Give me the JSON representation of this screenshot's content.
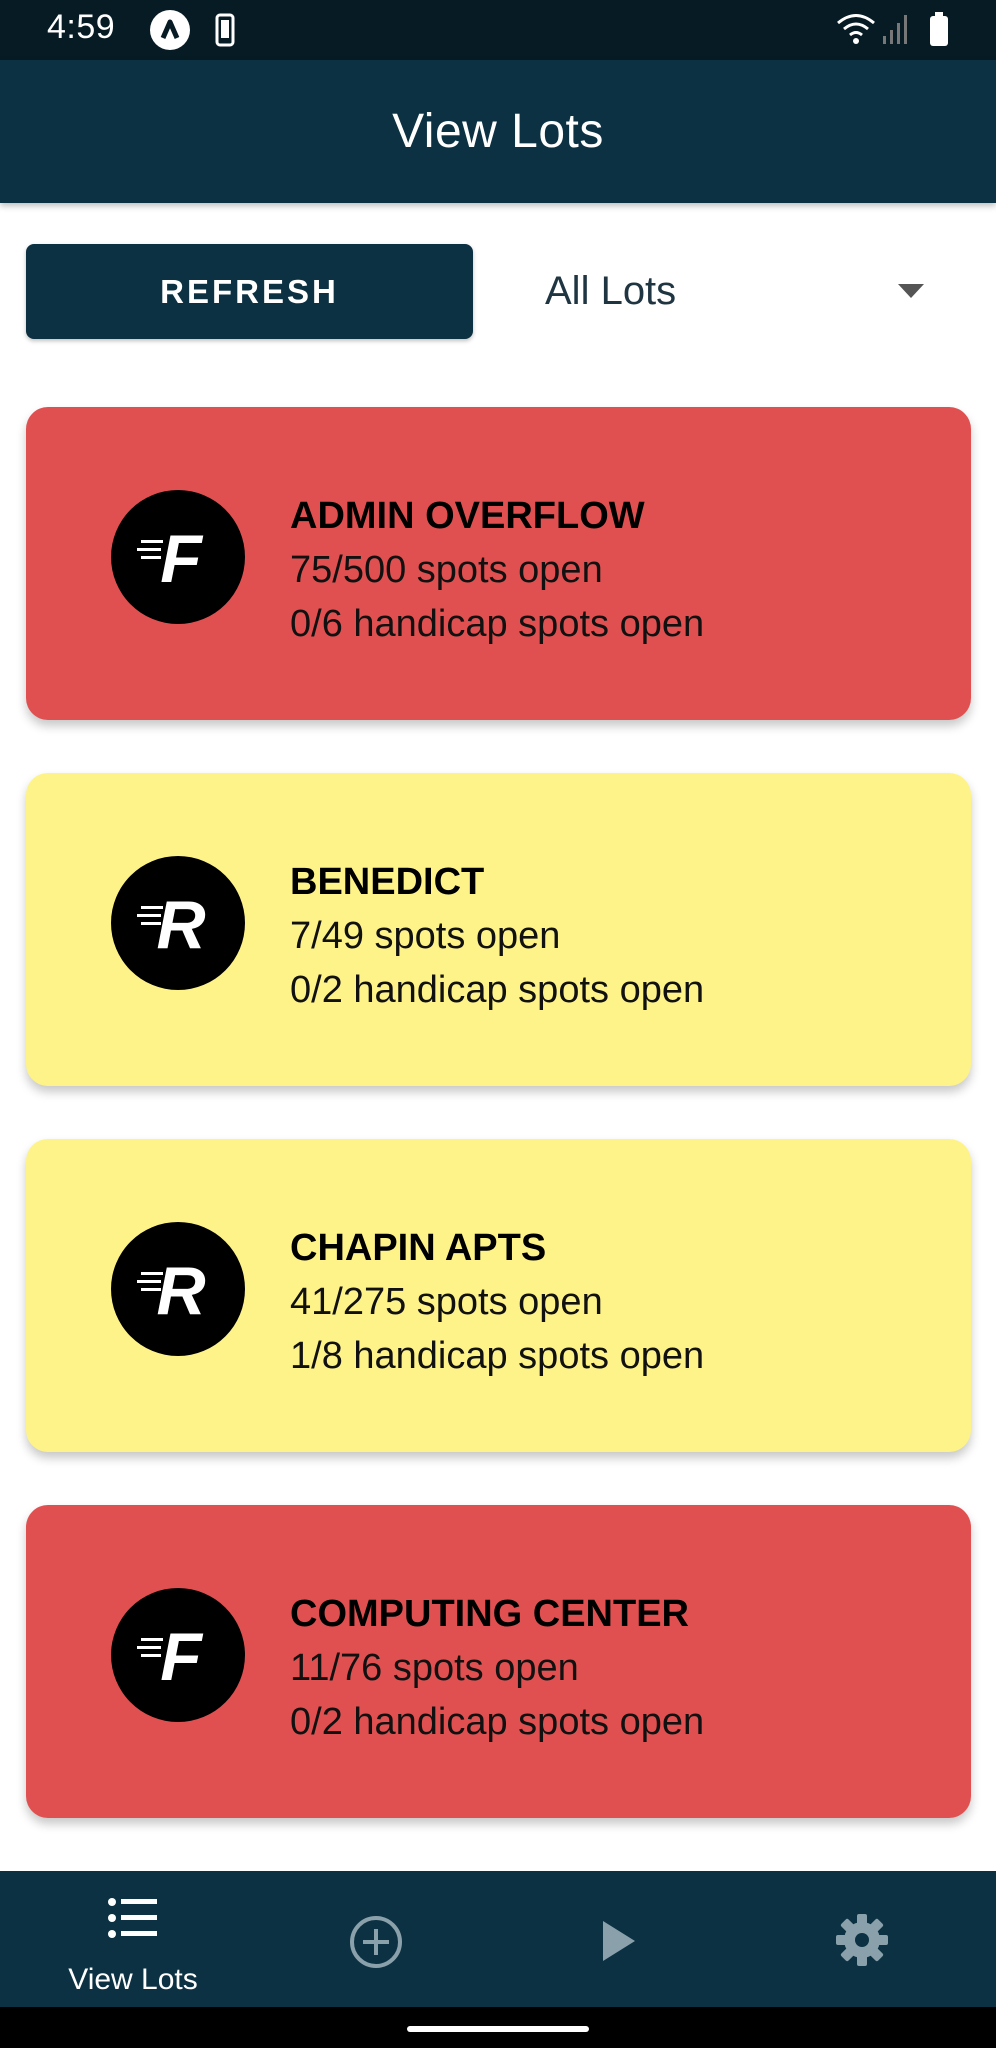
{
  "status_bar": {
    "time": "4:59",
    "icons": [
      "a-icon",
      "phone-icon",
      "wifi-icon",
      "signal-icon",
      "battery-icon"
    ]
  },
  "app_bar": {
    "title": "View Lots"
  },
  "controls": {
    "refresh_label": "REFRESH",
    "filter_value": "All Lots"
  },
  "colors": {
    "primary": "#0b3142",
    "full": "#e05050",
    "limited": "#fef389"
  },
  "lots": [
    {
      "name": "ADMIN OVERFLOW",
      "spots": "75/500 spots open",
      "handicap": "0/6 handicap spots open",
      "letter": "F",
      "color": "#e05050"
    },
    {
      "name": "BENEDICT",
      "spots": "7/49 spots open",
      "handicap": "0/2 handicap spots open",
      "letter": "R",
      "color": "#fef389"
    },
    {
      "name": "CHAPIN APTS",
      "spots": "41/275 spots open",
      "handicap": "1/8 handicap spots open",
      "letter": "R",
      "color": "#fef389"
    },
    {
      "name": "COMPUTING CENTER",
      "spots": "11/76 spots open",
      "handicap": "0/2 handicap spots open",
      "letter": "F",
      "color": "#e05050"
    }
  ],
  "bottom_nav": {
    "items": [
      {
        "icon": "list-icon",
        "label": "View Lots"
      },
      {
        "icon": "add-circle-icon",
        "label": ""
      },
      {
        "icon": "play-icon",
        "label": ""
      },
      {
        "icon": "gear-icon",
        "label": ""
      }
    ]
  }
}
